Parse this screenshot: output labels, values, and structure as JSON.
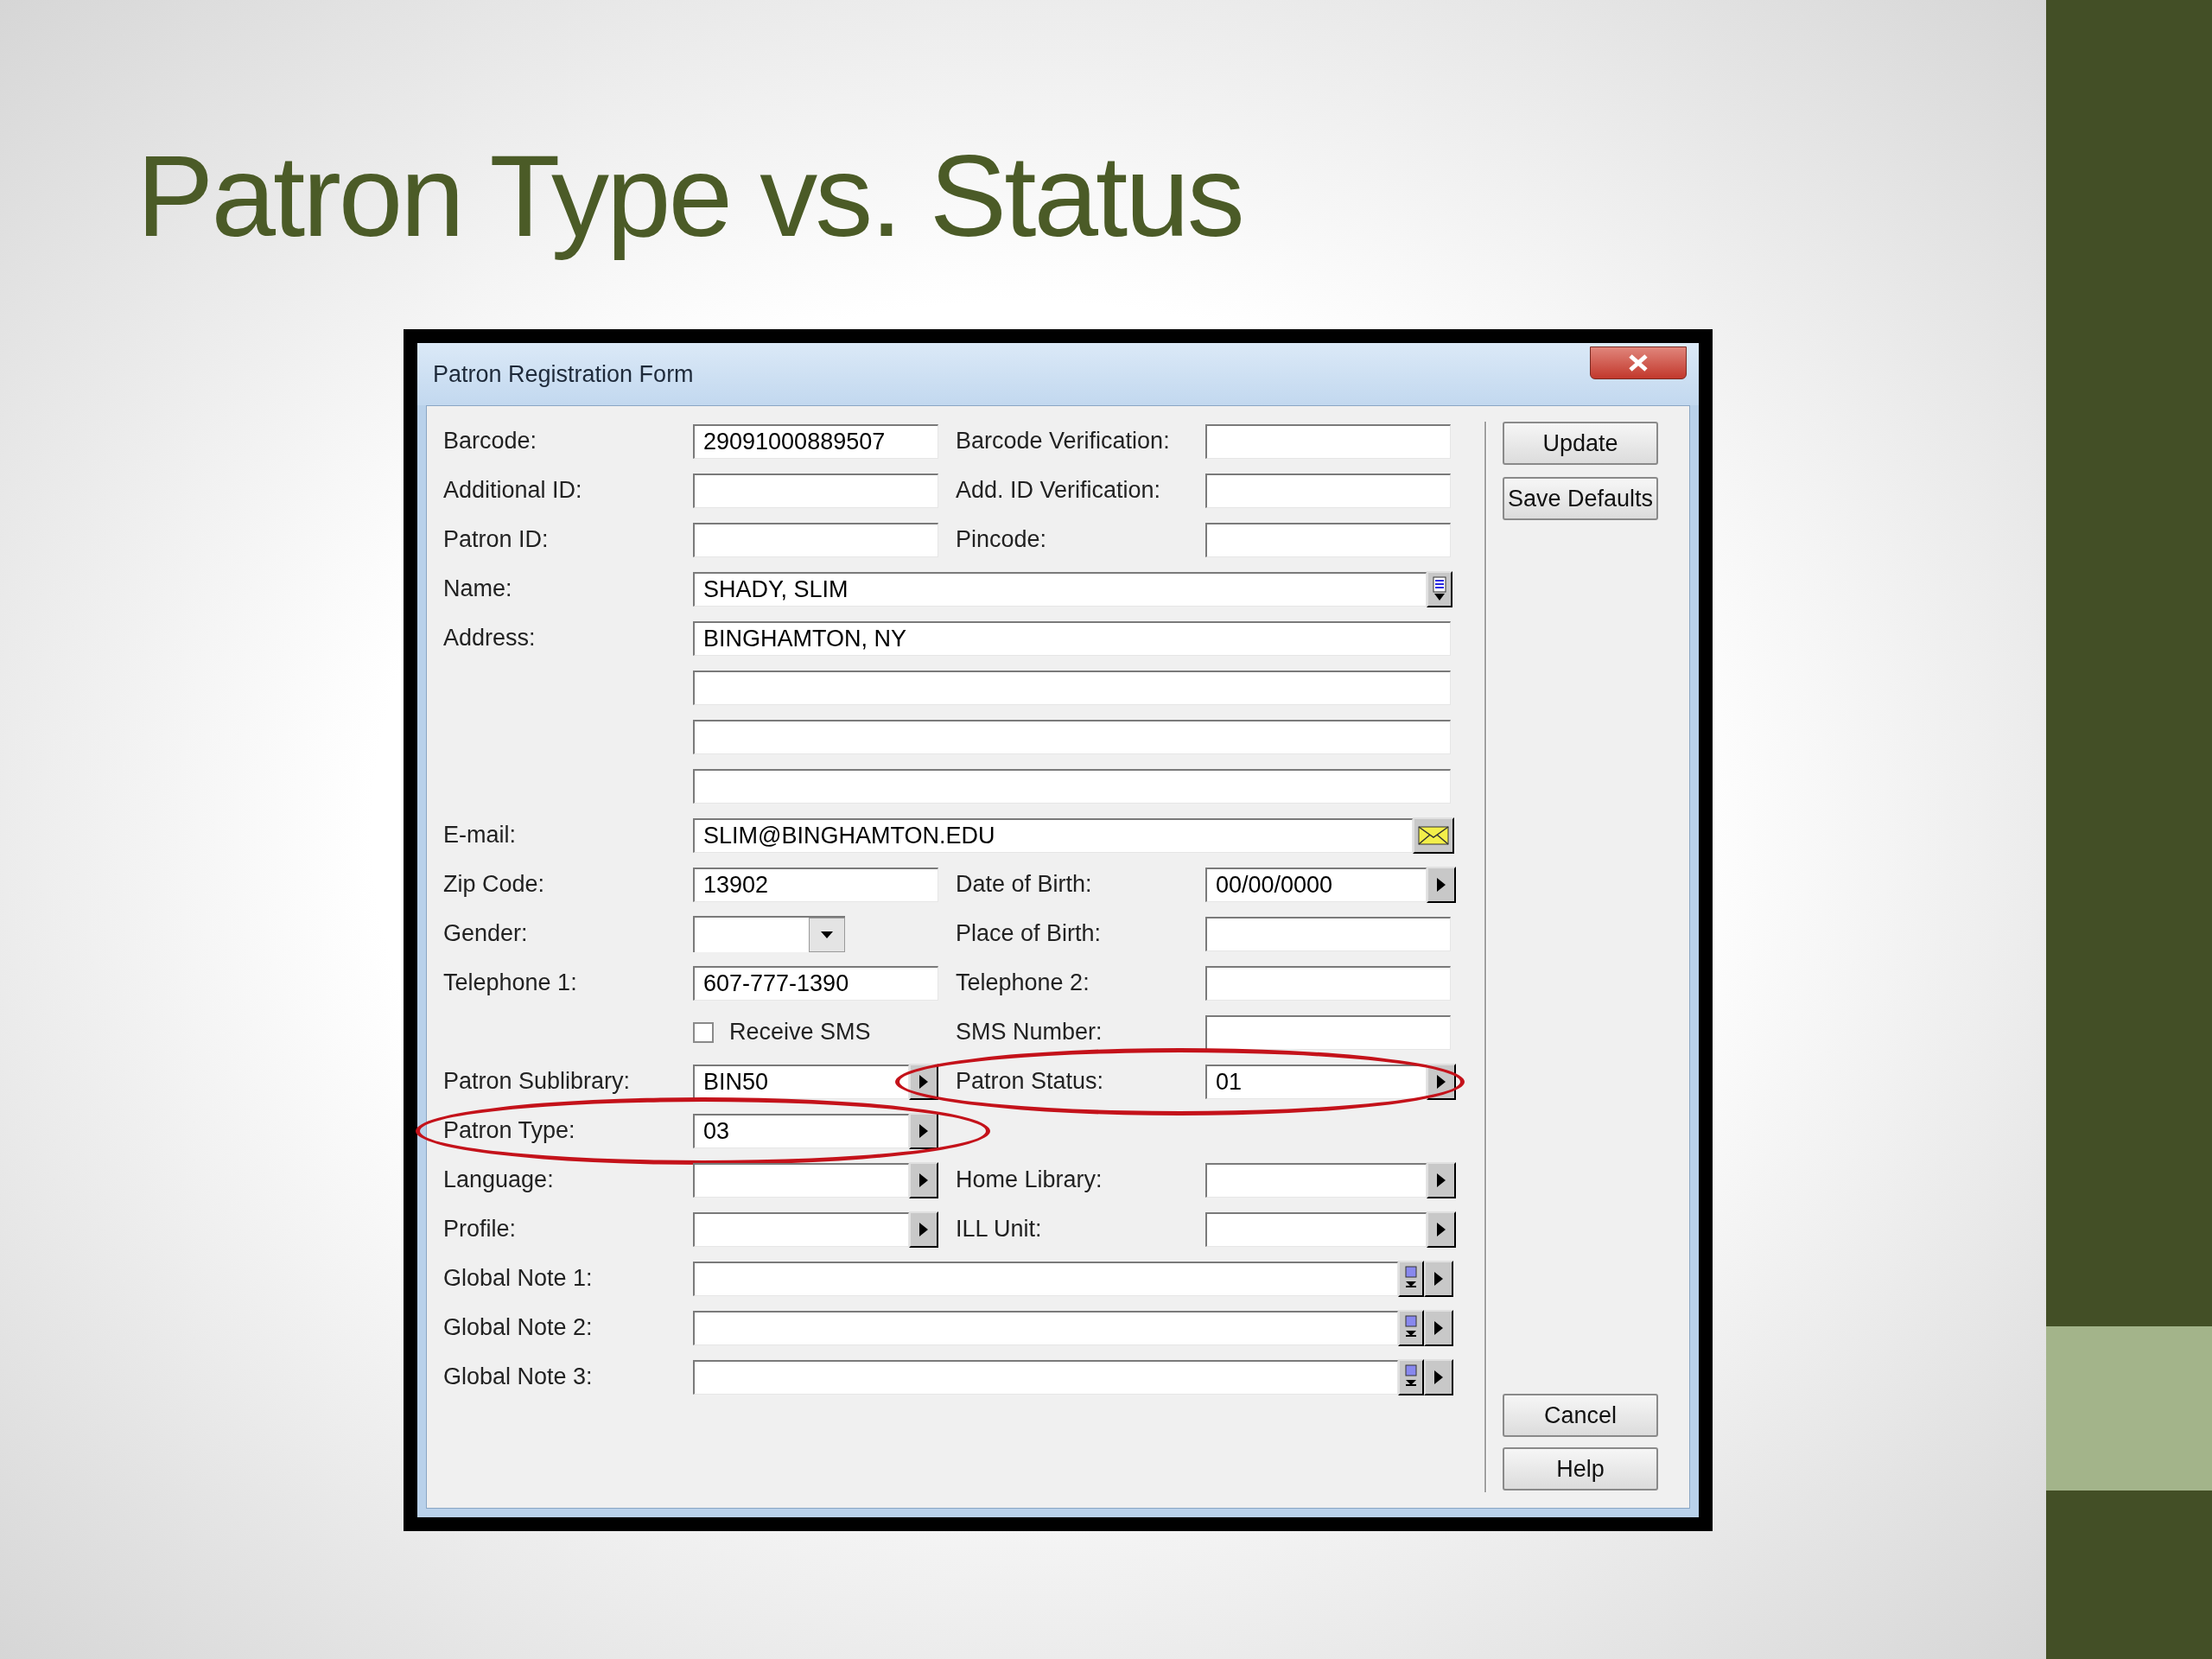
{
  "slide_title": "Patron Type vs. Status",
  "window": {
    "title": "Patron Registration Form"
  },
  "rows": [
    {
      "left": {
        "label": "Barcode:",
        "kind": "text",
        "value": "29091000889507"
      },
      "right": {
        "label": "Barcode Verification:",
        "kind": "text"
      }
    },
    {
      "left": {
        "label": "Additional ID:",
        "kind": "text"
      },
      "right": {
        "label": "Add. ID Verification:",
        "kind": "text"
      }
    },
    {
      "left": {
        "label": "Patron ID:",
        "kind": "text"
      },
      "right": {
        "label": "Pincode:",
        "kind": "text"
      }
    },
    {
      "wide": {
        "label": "Name:",
        "kind": "list",
        "value": "SHADY, SLIM"
      }
    },
    {
      "wide": {
        "label": "Address:",
        "kind": "text",
        "value": "BINGHAMTON, NY"
      }
    },
    {
      "wide": {
        "kind": "text"
      }
    },
    {
      "wide": {
        "kind": "text"
      }
    },
    {
      "wide": {
        "kind": "text"
      }
    },
    {
      "wide": {
        "label": "E-mail:",
        "kind": "mail",
        "value": "SLIM@BINGHAMTON.EDU"
      }
    },
    {
      "left": {
        "label": "Zip Code:",
        "kind": "text",
        "value": "13902"
      },
      "right": {
        "label": "Date of Birth:",
        "kind": "arrow",
        "value": "00/00/0000"
      }
    },
    {
      "left": {
        "label": "Gender:",
        "kind": "dropdown"
      },
      "right": {
        "label": "Place of Birth:",
        "kind": "text"
      }
    },
    {
      "left": {
        "label": "Telephone 1:",
        "kind": "text",
        "value": "607-777-1390"
      },
      "right": {
        "label": "Telephone 2:",
        "kind": "text"
      }
    },
    {
      "left": {
        "kind": "checkbox",
        "text": "Receive SMS",
        "checked": false
      },
      "right": {
        "label": "SMS Number:",
        "kind": "text"
      }
    },
    {
      "left": {
        "label": "Patron Sublibrary:",
        "kind": "arrow",
        "value": "BIN50"
      },
      "right": {
        "label": "Patron Status:",
        "kind": "arrow",
        "value": "01",
        "circled": true
      }
    },
    {
      "left": {
        "label": "Patron Type:",
        "kind": "arrow",
        "value": "03",
        "circled": true
      }
    },
    {
      "left": {
        "label": "Language:",
        "kind": "arrow"
      },
      "right": {
        "label": "Home Library:",
        "kind": "arrow"
      }
    },
    {
      "left": {
        "label": "Profile:",
        "kind": "arrow"
      },
      "right": {
        "label": "ILL Unit:",
        "kind": "arrow"
      }
    },
    {
      "wide": {
        "label": "Global Note 1:",
        "kind": "note"
      }
    },
    {
      "wide": {
        "label": "Global Note 2:",
        "kind": "note"
      }
    },
    {
      "wide": {
        "label": "Global Note 3:",
        "kind": "note"
      }
    }
  ],
  "buttons_top": [
    {
      "label": "Update"
    },
    {
      "label": "Save Defaults"
    }
  ],
  "buttons_bottom": [
    {
      "label": "Cancel"
    },
    {
      "label": "Help"
    }
  ]
}
